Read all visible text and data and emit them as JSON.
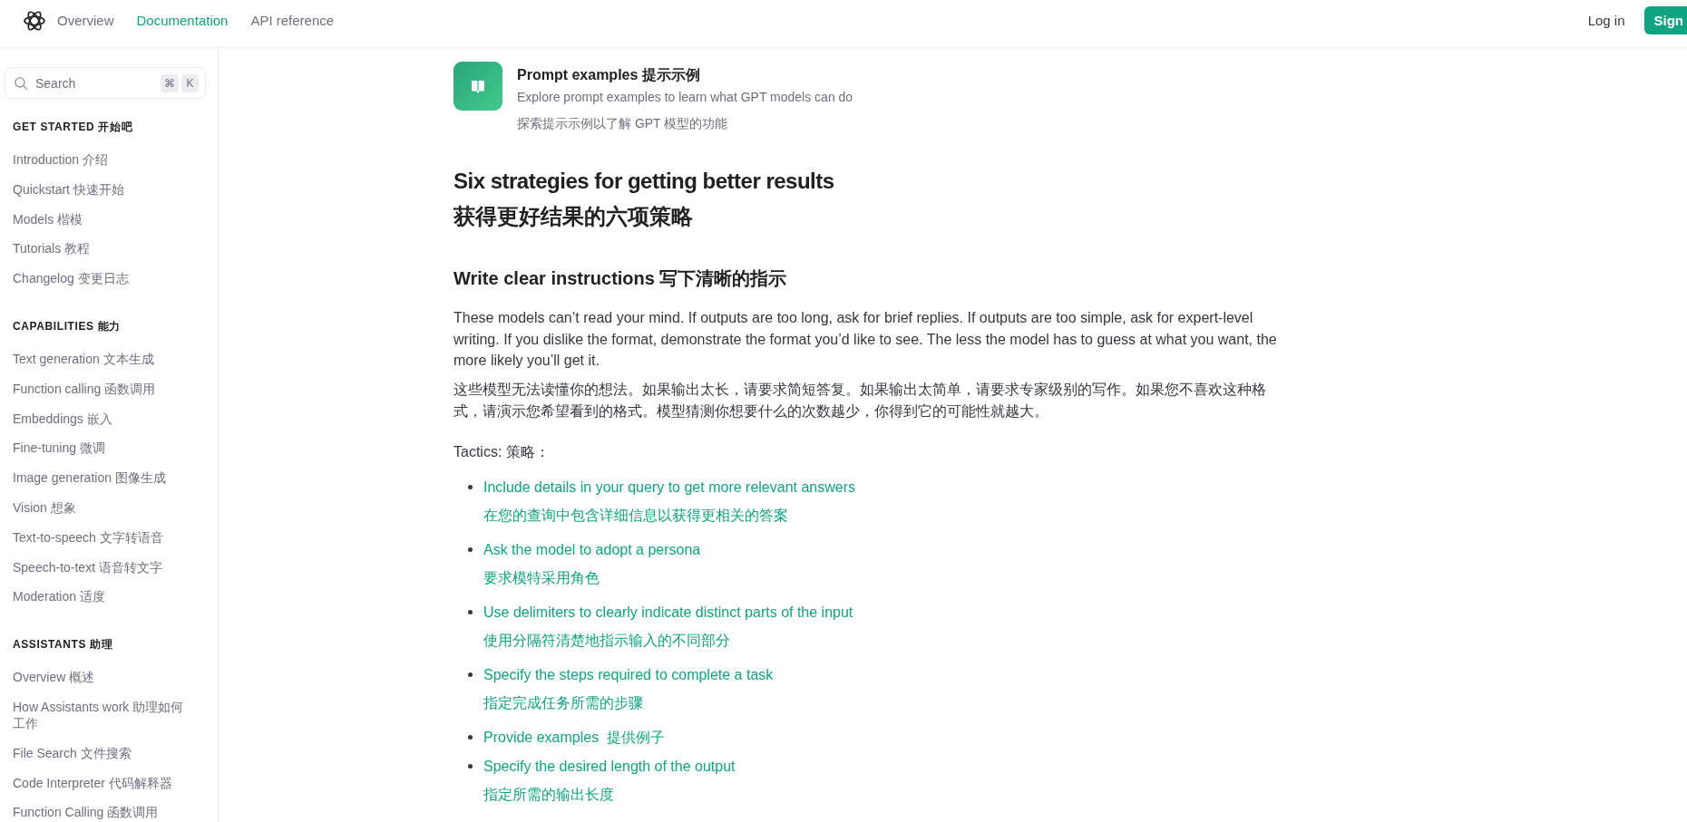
{
  "top_nav": {
    "tabs": [
      {
        "label": "Overview",
        "selected": false
      },
      {
        "label": "Documentation",
        "selected": true
      },
      {
        "label": "API reference",
        "selected": false
      }
    ],
    "login": "Log in",
    "signup": "Sign"
  },
  "sidebar": {
    "search": {
      "placeholder": "Search",
      "shortcut": [
        "⌘",
        "K"
      ]
    },
    "sections": [
      {
        "title": "GET STARTED 开始吧",
        "items": [
          "Introduction 介绍",
          "Quickstart 快速开始",
          "Models 楷模",
          "Tutorials 教程",
          "Changelog 变更日志"
        ]
      },
      {
        "title": "CAPABILITIES 能力",
        "items": [
          "Text generation 文本生成",
          "Function calling 函数调用",
          "Embeddings 嵌入",
          "Fine-tuning 微调",
          "Image generation 图像生成",
          "Vision 想象",
          "Text-to-speech 文字转语音",
          "Speech-to-text 语音转文字",
          "Moderation 适度"
        ]
      },
      {
        "title": "ASSISTANTS 助理",
        "items": [
          "Overview 概述",
          "How Assistants work 助理如何工作",
          "File Search 文件搜索",
          "Code Interpreter 代码解释器",
          "Function Calling 函数调用"
        ]
      }
    ]
  },
  "content": {
    "card": {
      "title": "Prompt examples 提示示例",
      "description": "Explore prompt examples to learn what GPT models can do",
      "description_translation": "探索提示示例以了解 GPT 模型的功能"
    },
    "heading": "Six strategies for getting better results",
    "heading_translation": "获得更好结果的六项策略",
    "section": {
      "heading": "Write clear instructions 写下清晰的指示",
      "paragraph": "These models can’t read your mind. If outputs are too long, ask for brief replies. If outputs are too simple, ask for expert-level writing. If you dislike the format, demonstrate the format you’d like to see. The less the model has to guess at what you want, the more likely you’ll get it.",
      "paragraph_translation": "这些模型无法读懂你的想法。如果输出太长，请要求简短答复。如果输出太简单，请要求专家级别的写作。如果您不喜欢这种格式，请演示您希望看到的格式。模型猜测你想要什么的次数越少，你得到它的可能性就越大。",
      "tactics_label": "Tactics: 策略：",
      "tactics": [
        {
          "text": "Include details in your query to get more relevant answers",
          "translation": "在您的查询中包含详细信息以获得更相关的答案"
        },
        {
          "text": "Ask the model to adopt a persona",
          "translation": "要求模特采用角色"
        },
        {
          "text": "Use delimiters to clearly indicate distinct parts of the input",
          "translation": "使用分隔符清楚地指示输入的不同部分"
        },
        {
          "text": "Specify the steps required to complete a task",
          "translation": "指定完成任务所需的步骤"
        },
        {
          "text": "Provide examples  提供例子"
        },
        {
          "text": "Specify the desired length of the output",
          "translation": "指定所需的输出长度"
        }
      ]
    }
  }
}
